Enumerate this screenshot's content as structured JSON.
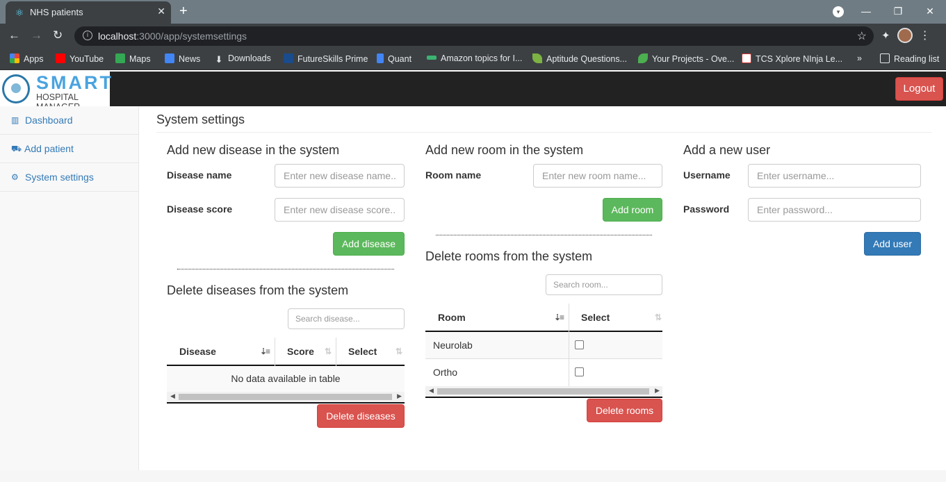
{
  "browser": {
    "tab_title": "NHS patients",
    "url_host": "localhost",
    "url_rest": ":3000/app/systemsettings",
    "bookmarks": [
      {
        "label": "Apps",
        "color": "#e94335"
      },
      {
        "label": "YouTube",
        "color": "#ff0000"
      },
      {
        "label": "Maps",
        "color": "#34a853"
      },
      {
        "label": "News",
        "color": "#4285f4"
      },
      {
        "label": "Downloads",
        "color": "#e8eaed"
      },
      {
        "label": "FutureSkills Prime",
        "color": "#1a4b8c"
      },
      {
        "label": "Quant",
        "color": "#4285f4"
      },
      {
        "label": "Amazon topics for I...",
        "color": "#3cb371"
      },
      {
        "label": "Aptitude Questions...",
        "color": "#7cb342"
      },
      {
        "label": "Your Projects - Ove...",
        "color": "#4caf50"
      },
      {
        "label": "TCS Xplore NInja Le...",
        "color": "#d32f2f"
      }
    ],
    "reading_list": "Reading list"
  },
  "app": {
    "logo_top": "SMART",
    "logo_bottom": "HOSPITAL MANAGER",
    "logout": "Logout"
  },
  "sidebar": {
    "items": [
      {
        "label": "Dashboard",
        "icon": "bar-chart-icon"
      },
      {
        "label": "Add patient",
        "icon": "ambulance-icon"
      },
      {
        "label": "System settings",
        "icon": "cogs-icon"
      }
    ]
  },
  "page_title": "System settings",
  "disease": {
    "heading": "Add new disease in the system",
    "name_label": "Disease name",
    "name_placeholder": "Enter new disease name...",
    "score_label": "Disease score",
    "score_placeholder": "Enter new disease score...",
    "add_button": "Add disease",
    "delete_heading": "Delete diseases from the system",
    "search_placeholder": "Search disease...",
    "columns": [
      "Disease",
      "Score",
      "Select"
    ],
    "empty_text": "No data available in table",
    "delete_button": "Delete diseases"
  },
  "room": {
    "heading": "Add new room in the system",
    "name_label": "Room name",
    "name_placeholder": "Enter new room name...",
    "add_button": "Add room",
    "delete_heading": "Delete rooms from the system",
    "search_placeholder": "Search room...",
    "columns": [
      "Room",
      "Select"
    ],
    "rows": [
      {
        "name": "Neurolab",
        "checked": false
      },
      {
        "name": "Ortho",
        "checked": false
      }
    ],
    "delete_button": "Delete rooms"
  },
  "user": {
    "heading": "Add a new user",
    "username_label": "Username",
    "username_placeholder": "Enter username...",
    "password_label": "Password",
    "password_placeholder": "Enter password...",
    "add_button": "Add user"
  }
}
